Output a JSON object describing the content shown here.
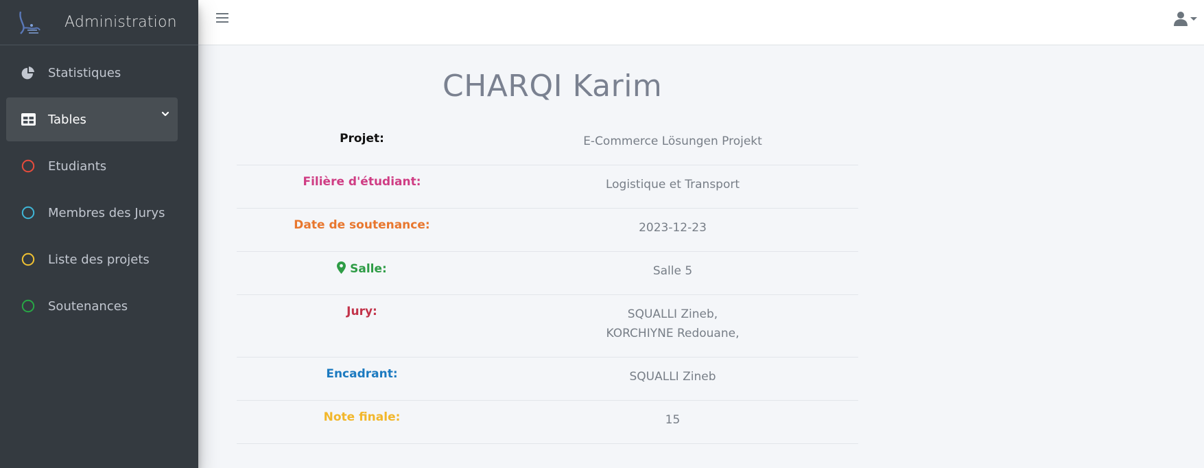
{
  "brand": {
    "title": "Administration"
  },
  "sidebar": {
    "items": [
      {
        "label": "Statistiques",
        "icon": "pie-chart-icon"
      },
      {
        "label": "Tables",
        "icon": "table-icon",
        "active": true
      },
      {
        "label": "Etudiants",
        "icon": "circle-outline-icon",
        "color": "#e74c3c"
      },
      {
        "label": "Membres des Jurys",
        "icon": "circle-outline-icon",
        "color": "#3fb6d7"
      },
      {
        "label": "Liste des projets",
        "icon": "circle-outline-icon",
        "color": "#f1c232"
      },
      {
        "label": "Soutenances",
        "icon": "circle-outline-icon",
        "color": "#28a745"
      }
    ]
  },
  "topbar": {
    "menu_icon": "hamburger-icon",
    "user_icon": "user-icon"
  },
  "student": {
    "name": "CHARQI Karim",
    "fields": {
      "projet": {
        "label": "Projet:",
        "value": "E-Commerce Lösungen Projekt"
      },
      "filiere": {
        "label": "Filière d'étudiant:",
        "value": "Logistique et Transport"
      },
      "date": {
        "label": "Date de soutenance:",
        "value": "2023-12-23"
      },
      "salle": {
        "label": "Salle:",
        "value": "Salle 5"
      },
      "jury": {
        "label": "Jury:",
        "values": [
          "SQUALLI Zineb,",
          "KORCHIYNE Redouane,"
        ]
      },
      "encadrant": {
        "label": "Encadrant:",
        "value": "SQUALLI Zineb"
      },
      "note": {
        "label": "Note finale:",
        "value": "15"
      }
    }
  }
}
